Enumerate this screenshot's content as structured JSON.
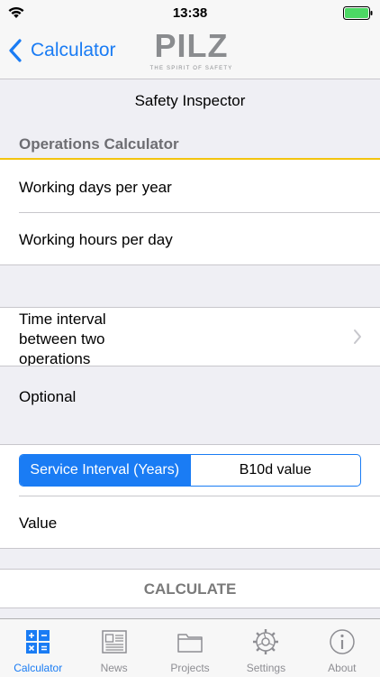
{
  "status_bar": {
    "time": "13:38"
  },
  "nav": {
    "back_label": "Calculator",
    "logo_text": "PILZ",
    "logo_tagline": "THE SPIRIT OF SAFETY"
  },
  "title": "Safety Inspector",
  "section": {
    "header": "Operations Calculator"
  },
  "fields": {
    "working_days": "Working days per year",
    "working_hours": "Working hours per day",
    "time_interval": "Time interval between two operations",
    "optional": "Optional",
    "value": "Value"
  },
  "segmented": {
    "options": [
      "Service Interval (Years)",
      "B10d value"
    ],
    "selected": "Service Interval (Years)"
  },
  "calculate_label": "CALCULATE",
  "tabs": [
    {
      "label": "Calculator",
      "icon": "calculator-icon",
      "active": true
    },
    {
      "label": "News",
      "icon": "news-icon",
      "active": false
    },
    {
      "label": "Projects",
      "icon": "folder-icon",
      "active": false
    },
    {
      "label": "Settings",
      "icon": "gear-icon",
      "active": false
    },
    {
      "label": "About",
      "icon": "info-icon",
      "active": false
    }
  ],
  "colors": {
    "accent": "#1a7cf4",
    "section_underline": "#f2c40f",
    "battery": "#4cd964"
  }
}
